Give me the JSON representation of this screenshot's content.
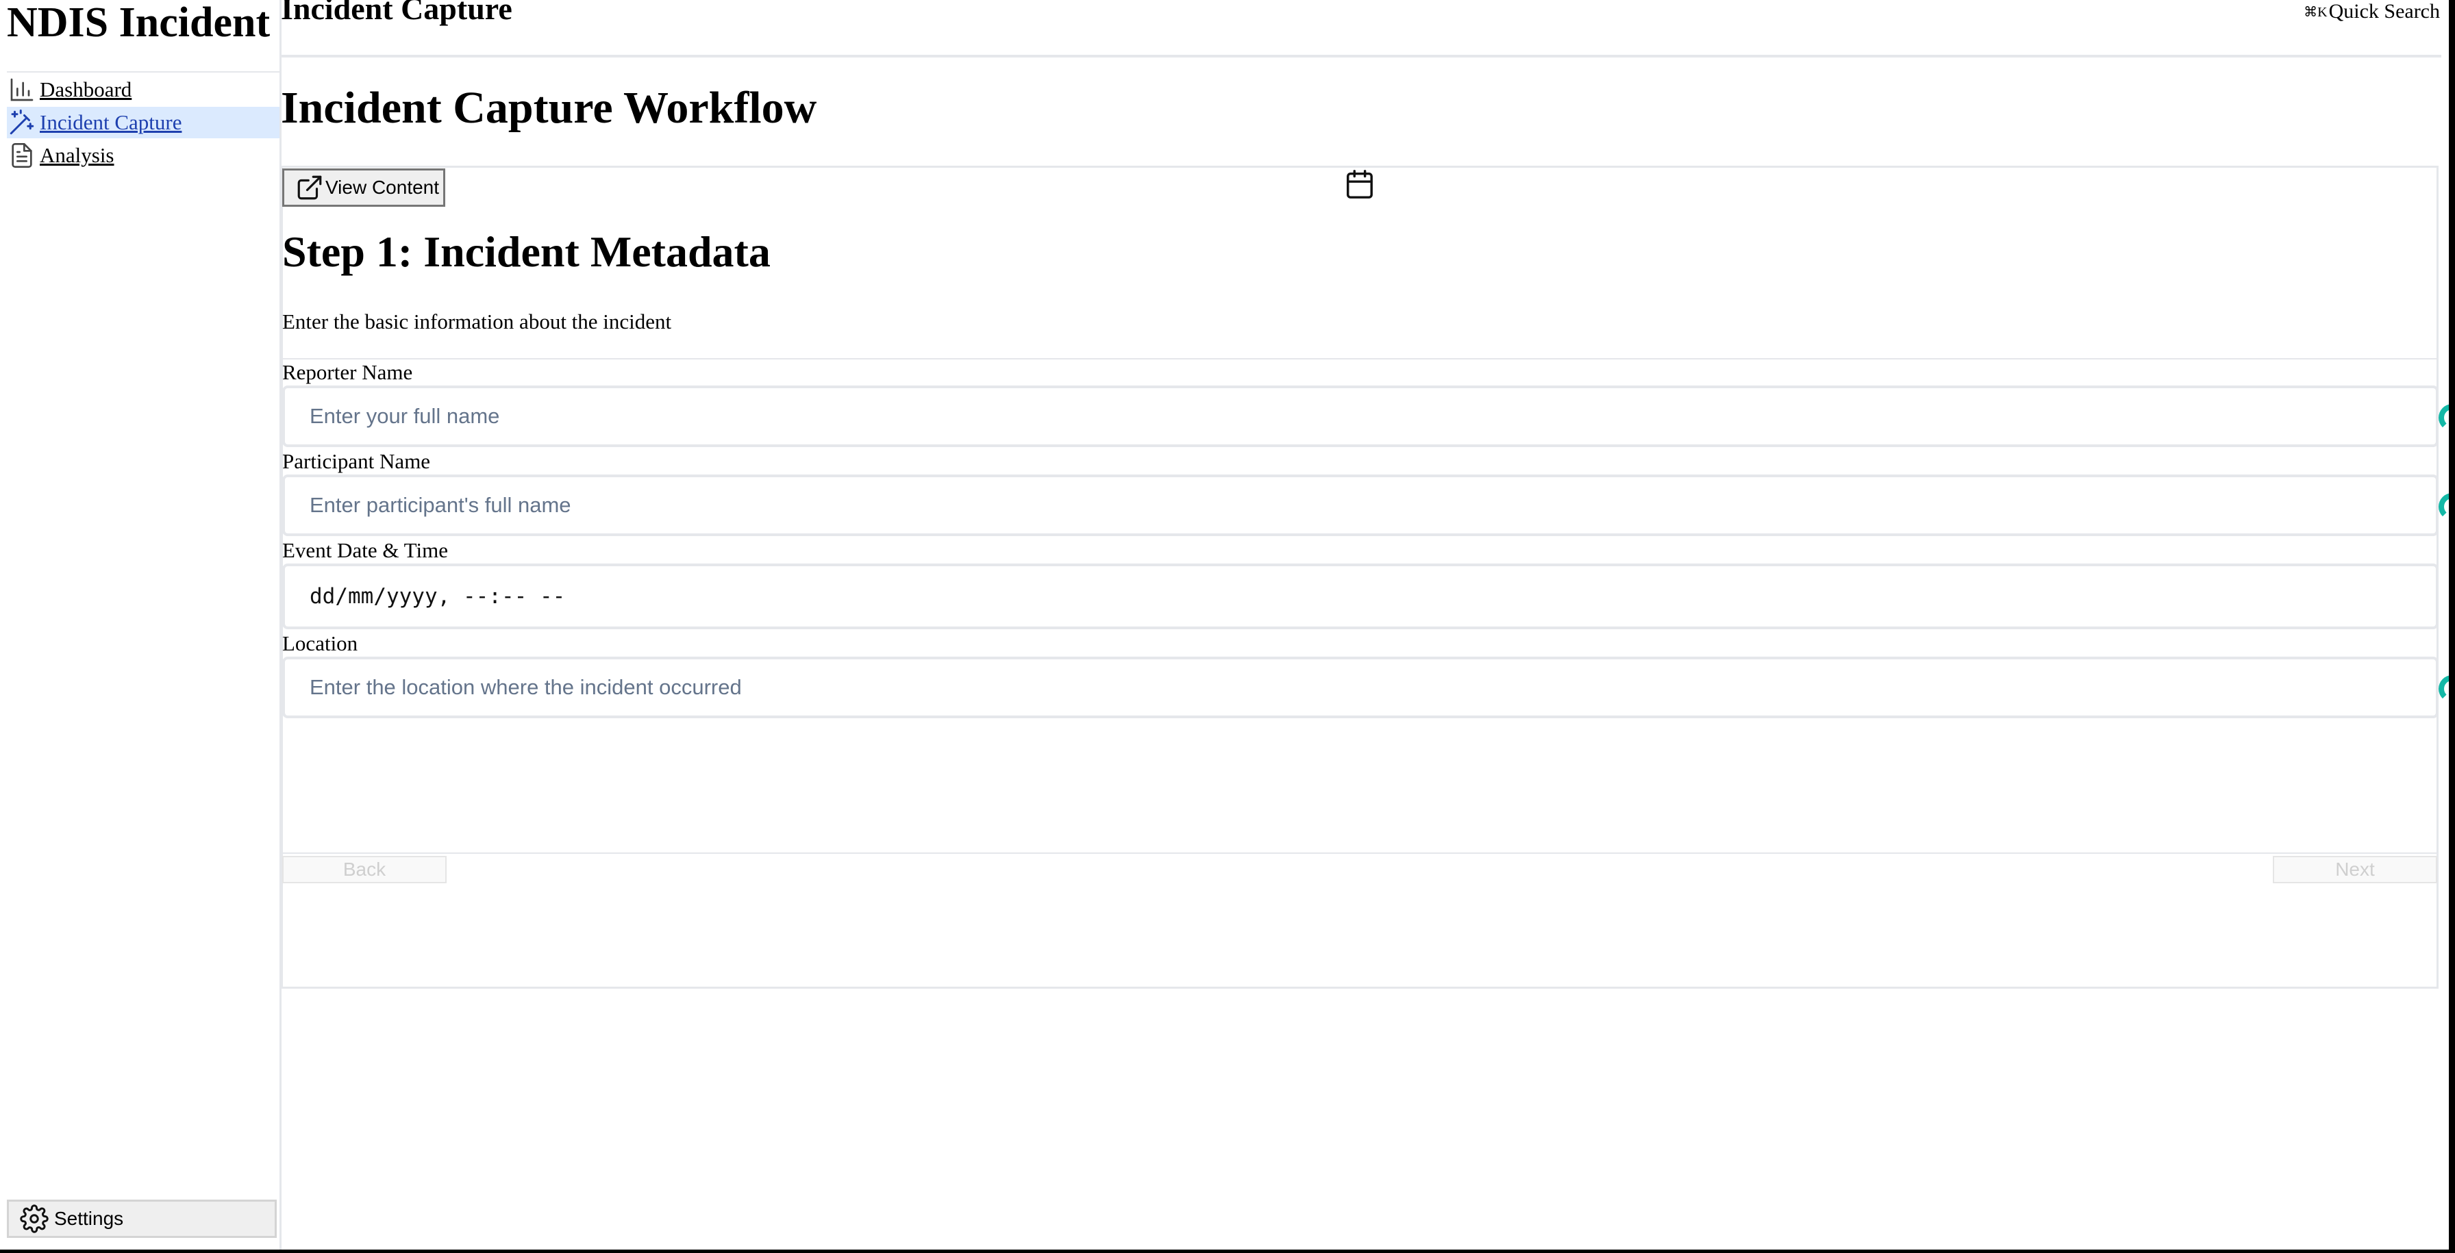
{
  "sidebar": {
    "brand": "NDIS Incident",
    "items": [
      {
        "label": "Dashboard",
        "icon": "bar-chart-icon",
        "active": false
      },
      {
        "label": "Incident Capture",
        "icon": "wand-icon",
        "active": true
      },
      {
        "label": "Analysis",
        "icon": "document-icon",
        "active": false
      }
    ],
    "settings_label": "Settings"
  },
  "header": {
    "title": "Incident Capture",
    "quick_search_shortcut": "⌘K",
    "quick_search_label": "Quick Search"
  },
  "page": {
    "title": "Incident Capture Workflow"
  },
  "workflow": {
    "view_content_label": "View Content",
    "step_title": "Step 1: Incident Metadata",
    "step_description": "Enter the basic information about the incident",
    "fields": [
      {
        "label": "Reporter Name",
        "placeholder": "Enter your full name",
        "value": ""
      },
      {
        "label": "Participant Name",
        "placeholder": "Enter participant's full name",
        "value": ""
      },
      {
        "label": "Event Date & Time",
        "placeholder": "dd/mm/yyyy, --:-- --",
        "value": ""
      },
      {
        "label": "Location",
        "placeholder": "Enter the location where the incident occurred",
        "value": ""
      }
    ],
    "back_label": "Back",
    "next_label": "Next"
  },
  "colors": {
    "accent": "#1e40af",
    "active_bg": "#dbeafe",
    "teal": "#14b8a6",
    "border": "#e5e7eb"
  }
}
